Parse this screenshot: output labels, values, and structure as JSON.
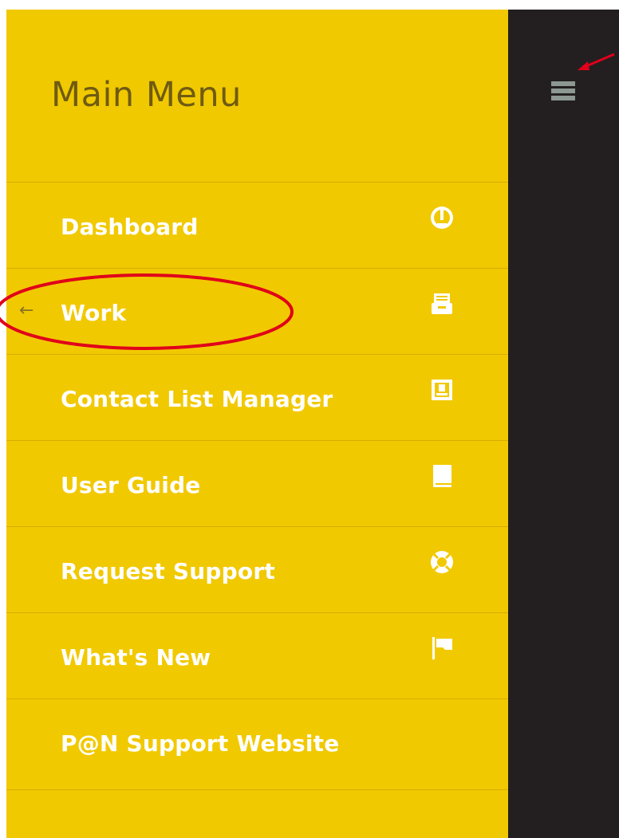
{
  "menu": {
    "title": "Main Menu",
    "items": [
      {
        "label": "Dashboard",
        "icon": "dashboard-gauge-icon"
      },
      {
        "label": "Work",
        "icon": "inbox-tray-icon"
      },
      {
        "label": "Contact List Manager",
        "icon": "contact-card-icon"
      },
      {
        "label": "User Guide",
        "icon": "book-icon"
      },
      {
        "label": "Request Support",
        "icon": "lifebuoy-icon"
      },
      {
        "label": "What's New",
        "icon": "flag-icon"
      },
      {
        "label": "P@N Support Website",
        "icon": ""
      }
    ],
    "active_arrow": "←"
  },
  "colors": {
    "menu_bg": "#f1c900",
    "side_bg": "#231f20",
    "label": "#ffffff",
    "title": "#6f5b12",
    "annotation": "#e0001a"
  },
  "icons": {
    "hamburger": "hamburger-menu-icon"
  }
}
